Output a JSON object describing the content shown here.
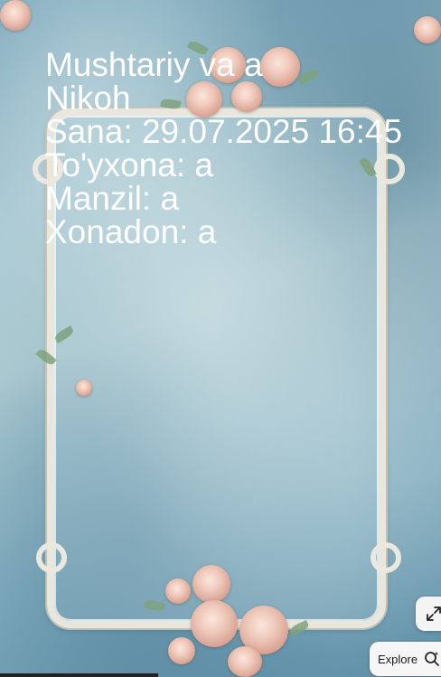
{
  "card": {
    "lines": [
      "Mushtariy va a",
      "Nikoh",
      "Sana: 29.07.2025 16:45",
      "To'yxona: a",
      "Manzil: a",
      "Xonadon: a"
    ]
  },
  "controls": {
    "explore_label": "Explore",
    "fullscreen_icon": "expand-icon",
    "explore_icon": "visual-search-icon"
  },
  "colors": {
    "text": "#ffffff",
    "frame": "#e9e7dd",
    "background": "#8fb6c5"
  }
}
